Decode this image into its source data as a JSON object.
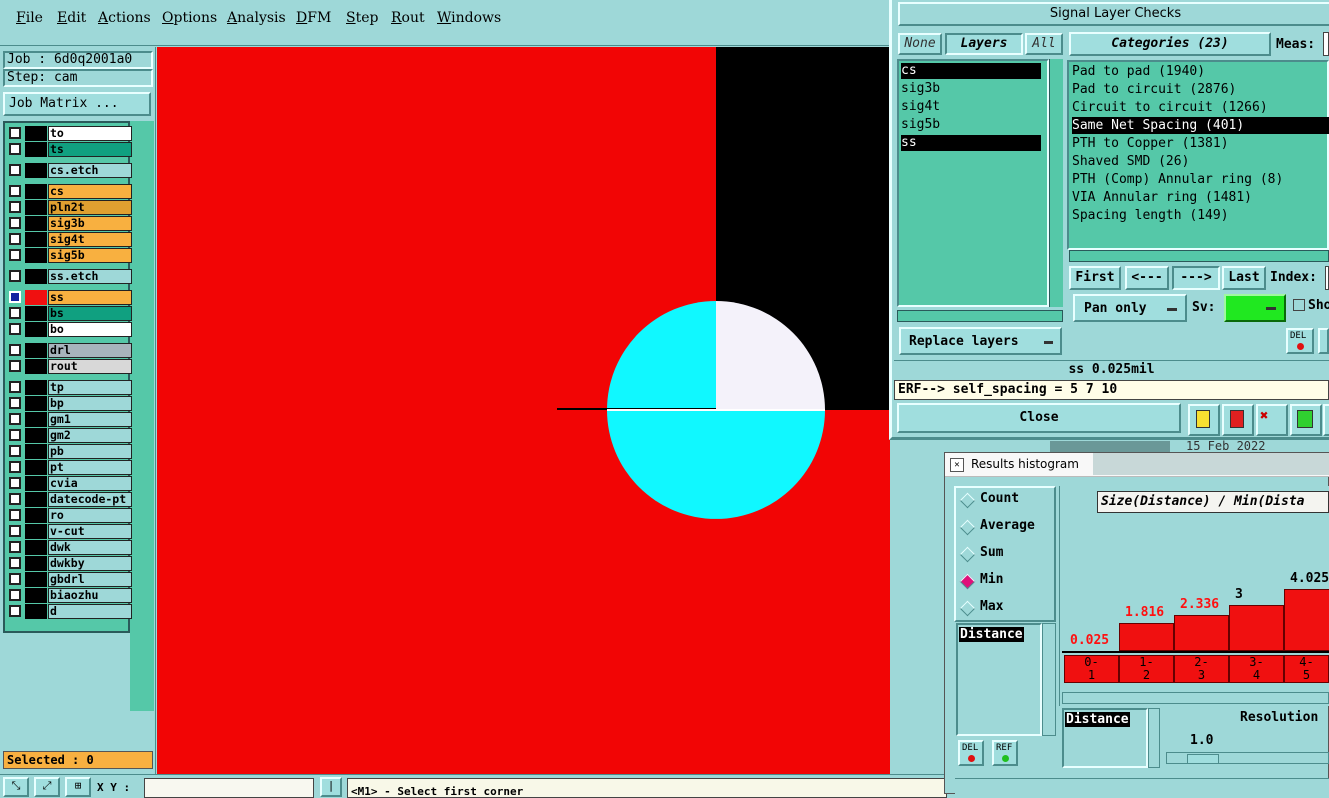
{
  "menu": [
    "File",
    "Edit",
    "Actions",
    "Options",
    "Analysis",
    "DFM",
    "Step",
    "Rout",
    "Windows"
  ],
  "job": {
    "job_label": "Job : 6d0q2001a0",
    "step_label": "Step: cam",
    "matrix_btn": "Job Matrix ..."
  },
  "layers": [
    {
      "name": "to",
      "color": "#ffffff",
      "flag": "✎"
    },
    {
      "name": "ts",
      "color": "#10a080",
      "flag": ""
    },
    {
      "name": "cs.etch",
      "color": "#9ed8d8",
      "flag": ""
    },
    {
      "name": "cs",
      "color": "#f8b040",
      "flag": "✎"
    },
    {
      "name": "pln2t",
      "color": "#e0a030",
      "flag": ""
    },
    {
      "name": "sig3b",
      "color": "#f8b040",
      "flag": ""
    },
    {
      "name": "sig4t",
      "color": "#f8b040",
      "flag": "✎"
    },
    {
      "name": "sig5b",
      "color": "#f8b040",
      "flag": "✎"
    },
    {
      "name": "ss.etch",
      "color": "#9ed8d8",
      "flag": ""
    },
    {
      "name": "ss",
      "color": "#f8b040",
      "flag": "✎▣"
    },
    {
      "name": "bs",
      "color": "#10a080",
      "flag": ""
    },
    {
      "name": "bo",
      "color": "#ffffff",
      "flag": "✎"
    },
    {
      "name": "drl",
      "color": "#a8b4bc",
      "flag": ""
    },
    {
      "name": "rout",
      "color": "#d8d8d8",
      "flag": ""
    },
    {
      "name": "tp",
      "color": "#9ed8d8",
      "flag": ""
    },
    {
      "name": "bp",
      "color": "#9ed8d8",
      "flag": ""
    },
    {
      "name": "gm1",
      "color": "#9ed8d8",
      "flag": ""
    },
    {
      "name": "gm2",
      "color": "#9ed8d8",
      "flag": ""
    },
    {
      "name": "pb",
      "color": "#9ed8d8",
      "flag": ""
    },
    {
      "name": "pt",
      "color": "#9ed8d8",
      "flag": ""
    },
    {
      "name": "cvia",
      "color": "#9ed8d8",
      "flag": ""
    },
    {
      "name": "datecode-pt",
      "color": "#9ed8d8",
      "flag": ""
    },
    {
      "name": "ro",
      "color": "#9ed8d8",
      "flag": ""
    },
    {
      "name": "v-cut",
      "color": "#9ed8d8",
      "flag": ""
    },
    {
      "name": "dwk",
      "color": "#9ed8d8",
      "flag": ""
    },
    {
      "name": "dwkby",
      "color": "#9ed8d8",
      "flag": ""
    },
    {
      "name": "gbdrl",
      "color": "#9ed8d8",
      "flag": ""
    },
    {
      "name": "biaozhu",
      "color": "#9ed8d8",
      "flag": ""
    },
    {
      "name": "d",
      "color": "#9ed8d8",
      "flag": ""
    }
  ],
  "selected": "Selected : 0",
  "status": {
    "xy_label": "X Y :",
    "prompt": "<M1> - Select first corner"
  },
  "checks": {
    "title": "Signal Layer Checks",
    "none_btn": "None",
    "layers_btn": "Layers",
    "all_btn": "All",
    "categories_btn": "Categories (23)",
    "meas_label": "Meas:",
    "layer_list": [
      "cs",
      "sig3b",
      "sig4t",
      "sig5b",
      "ss"
    ],
    "categories": [
      "Pad to pad (1940)",
      "Pad to circuit (2876)",
      "Circuit to circuit (1266)",
      "Same Net Spacing (401)",
      "PTH to Copper (1381)",
      "Shaved SMD (26)",
      "PTH (Comp) Annular ring (8)",
      "VIA Annular ring (1481)",
      "Spacing length (149)"
    ],
    "nav": {
      "first": "First",
      "prev": "<---",
      "next": "--->",
      "last": "Last",
      "index": "Index:"
    },
    "pan": "Pan only",
    "sv": "Sv:",
    "show": "Sho",
    "replace": "Replace layers",
    "info": "ss 0.025mil",
    "erf": "ERF--> self_spacing = 5 7 10",
    "close": "Close",
    "del": "DEL",
    "date": "15 Feb 2022"
  },
  "hist": {
    "title": "Results histogram",
    "radios": [
      "Count",
      "Average",
      "Sum",
      "Min",
      "Max"
    ],
    "selected_radio": "Min",
    "attr_list": [
      "Distance"
    ],
    "header": "Size(Distance) / Min(Dista",
    "chart_data": {
      "type": "bar",
      "categories": [
        "0-1",
        "1-2",
        "2-3",
        "3-4",
        "4-5"
      ],
      "values": [
        0.025,
        1.816,
        2.336,
        3,
        4.025
      ],
      "value_labels": [
        "0.025",
        "1.816",
        "2.336",
        "3",
        "4.025"
      ],
      "bin_labels": [
        [
          "0-",
          "1"
        ],
        [
          "1-",
          "2"
        ],
        [
          "2-",
          "3"
        ],
        [
          "3-",
          "4"
        ],
        [
          "4-",
          "5"
        ]
      ]
    },
    "attr2": "Distance",
    "resolution_label": "Resolution",
    "resolution_value": "1.0",
    "del": "DEL",
    "ref": "REF"
  }
}
